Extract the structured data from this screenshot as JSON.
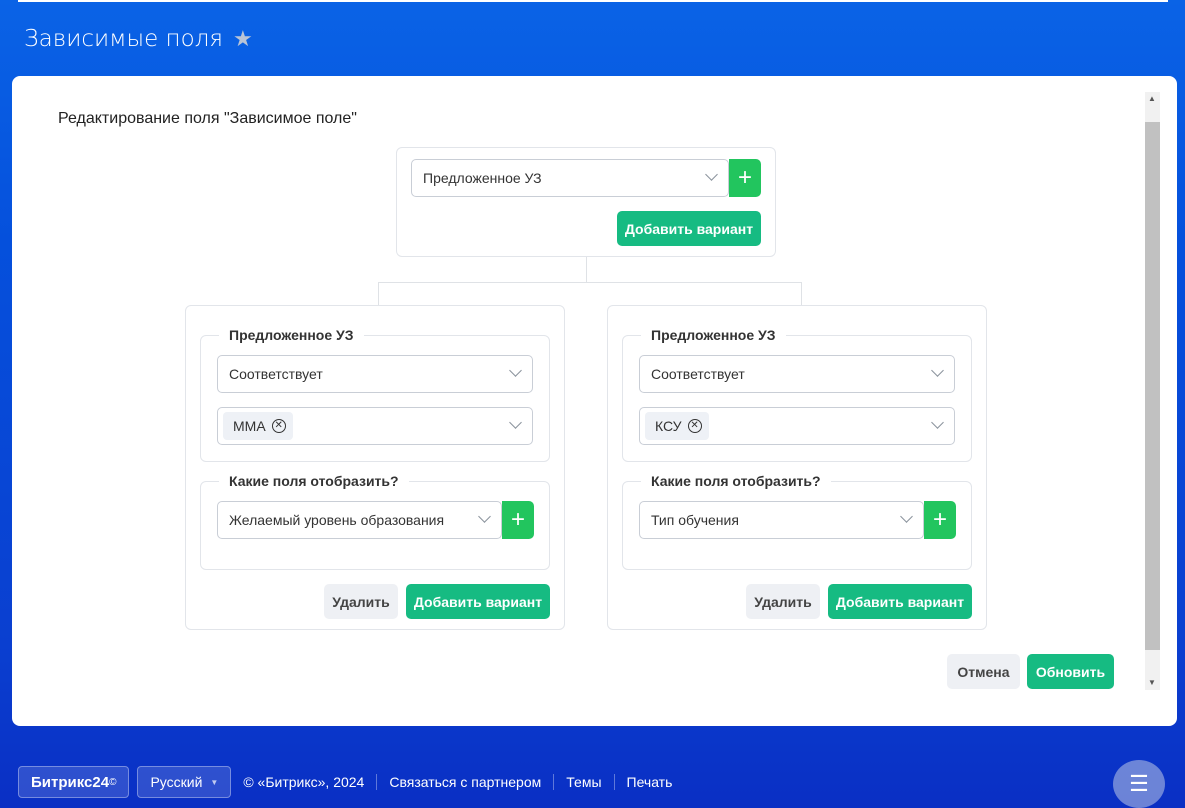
{
  "page": {
    "title": "Зависимые поля"
  },
  "editor": {
    "heading": "Редактирование поля \"Зависимое поле\"",
    "root": {
      "field": "Предложенное УЗ",
      "add_variant": "Добавить вариант"
    },
    "branches": [
      {
        "condition_legend": "Предложенное УЗ",
        "condition": "Соответствует",
        "value_tag": "ММА",
        "fields_legend": "Какие поля отобразить?",
        "field": "Желаемый уровень образования",
        "delete": "Удалить",
        "add_variant": "Добавить вариант"
      },
      {
        "condition_legend": "Предложенное УЗ",
        "condition": "Соответствует",
        "value_tag": "КСУ",
        "fields_legend": "Какие поля отобразить?",
        "field": "Тип обучения",
        "delete": "Удалить",
        "add_variant": "Добавить вариант"
      }
    ],
    "cancel": "Отмена",
    "update": "Обновить"
  },
  "footer": {
    "logo": "Битрикс24",
    "logo_mark": "©",
    "language": "Русский",
    "copyright": "© «Битрикс», 2024",
    "links": [
      "Связаться с партнером",
      "Темы",
      "Печать"
    ]
  }
}
